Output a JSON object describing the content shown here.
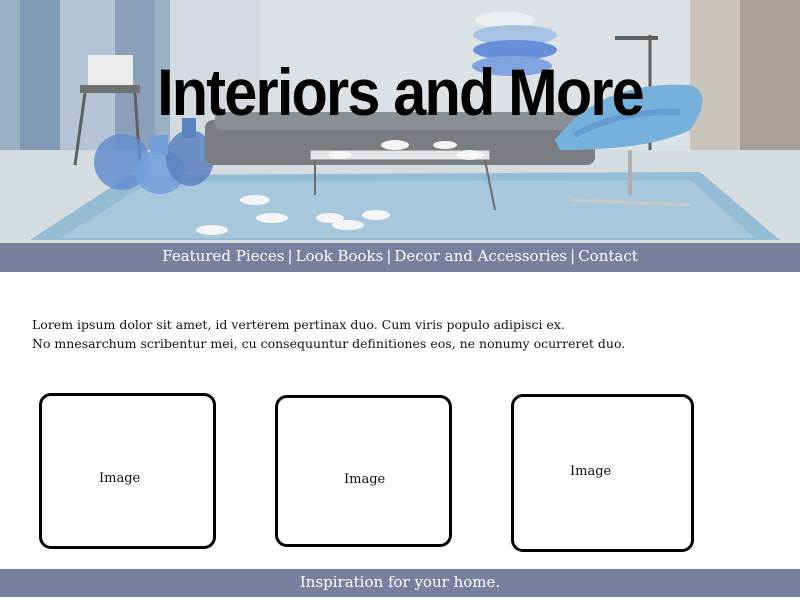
{
  "header": {
    "title": "Interiors and More"
  },
  "nav": {
    "items": [
      {
        "label": "Featured Pieces"
      },
      {
        "label": "Look Books"
      },
      {
        "label": "Decor and Accessories"
      },
      {
        "label": "Contact"
      }
    ],
    "separator": "|"
  },
  "intro": {
    "line1": "Lorem ipsum dolor sit amet, id verterem pertinax duo. Cum viris populo adipisci ex.",
    "line2": "No mnesarchum scribentur mei, cu consequuntur definitiones eos, ne nonumy ocurreret duo."
  },
  "gallery": {
    "items": [
      {
        "label": "Image"
      },
      {
        "label": "Image"
      },
      {
        "label": "Image"
      }
    ]
  },
  "footer": {
    "text": "Inspiration for your home."
  },
  "colors": {
    "bar": "#7880a0",
    "bar_text": "#ffffff",
    "hero_accent": "#3a7fc4"
  },
  "icons": {
    "hero": "living-room-photo"
  }
}
